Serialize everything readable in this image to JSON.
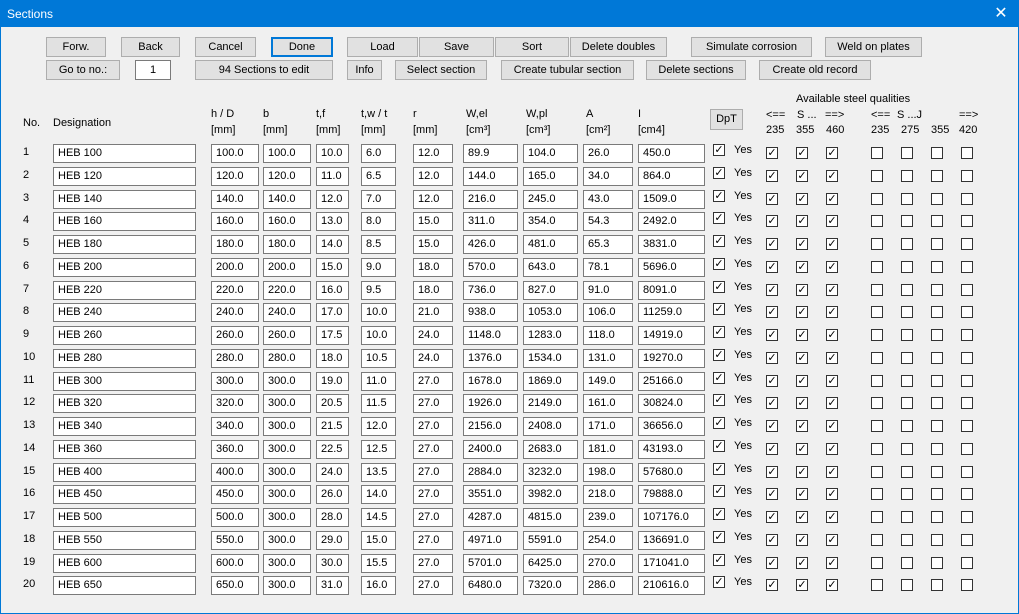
{
  "window": {
    "title": "Sections",
    "close_glyph": "✕"
  },
  "toolbar": {
    "forw": "Forw.",
    "back": "Back",
    "cancel": "Cancel",
    "done": "Done",
    "load": "Load",
    "save": "Save",
    "sort": "Sort",
    "delete_doubles": "Delete doubles",
    "simulate_corrosion": "Simulate corrosion",
    "weld_on_plates": "Weld on plates",
    "go_to_no": "Go to no.:",
    "go_to_value": "1",
    "sections_to_edit": "94 Sections to edit",
    "info": "Info",
    "select_section": "Select section",
    "create_tubular": "Create tubular section",
    "delete_sections": "Delete sections",
    "create_old_record": "Create old record"
  },
  "headers": {
    "no": "No.",
    "designation": "Designation",
    "h": "h / D",
    "b": "b",
    "tf": "t,f",
    "tw": "t,w / t",
    "r": "r",
    "wel": "W,el",
    "wpl": "W,pl",
    "a": "A",
    "i": "I",
    "u_h": "[mm]",
    "u_b": "[mm]",
    "u_tf": "[mm]",
    "u_tw": "[mm]",
    "u_r": "[mm]",
    "u_wel": "[cm³]",
    "u_wpl": "[cm³]",
    "u_a": "[cm²]",
    "u_i": "[cm4]",
    "dpt": "DpT",
    "available": "Available steel qualities",
    "g1_arrow_l": "<==",
    "g1_mid": "S ...",
    "g1_arrow_r": "==>",
    "g2_arrow_l": "<==",
    "g2_mid": "S ...J",
    "g2_arrow_r": "==>",
    "q1": "235",
    "q2": "355",
    "q3": "460",
    "q4": "235",
    "q5": "275",
    "q6": "355",
    "q7": "420"
  },
  "yes_label": "Yes",
  "check_glyph": "✓",
  "rows": [
    {
      "no": "1",
      "designation": "HEB 100",
      "h": "100.0",
      "b": "100.0",
      "tf": "10.0",
      "tw": "6.0",
      "r": "12.0",
      "wel": "89.9",
      "wpl": "104.0",
      "a": "26.0",
      "i": "450.0",
      "dpt": true,
      "q": [
        true,
        true,
        true,
        false,
        false,
        false,
        false
      ]
    },
    {
      "no": "2",
      "designation": "HEB 120",
      "h": "120.0",
      "b": "120.0",
      "tf": "11.0",
      "tw": "6.5",
      "r": "12.0",
      "wel": "144.0",
      "wpl": "165.0",
      "a": "34.0",
      "i": "864.0",
      "dpt": true,
      "q": [
        true,
        true,
        true,
        false,
        false,
        false,
        false
      ]
    },
    {
      "no": "3",
      "designation": "HEB 140",
      "h": "140.0",
      "b": "140.0",
      "tf": "12.0",
      "tw": "7.0",
      "r": "12.0",
      "wel": "216.0",
      "wpl": "245.0",
      "a": "43.0",
      "i": "1509.0",
      "dpt": true,
      "q": [
        true,
        true,
        true,
        false,
        false,
        false,
        false
      ]
    },
    {
      "no": "4",
      "designation": "HEB 160",
      "h": "160.0",
      "b": "160.0",
      "tf": "13.0",
      "tw": "8.0",
      "r": "15.0",
      "wel": "311.0",
      "wpl": "354.0",
      "a": "54.3",
      "i": "2492.0",
      "dpt": true,
      "q": [
        true,
        true,
        true,
        false,
        false,
        false,
        false
      ]
    },
    {
      "no": "5",
      "designation": "HEB 180",
      "h": "180.0",
      "b": "180.0",
      "tf": "14.0",
      "tw": "8.5",
      "r": "15.0",
      "wel": "426.0",
      "wpl": "481.0",
      "a": "65.3",
      "i": "3831.0",
      "dpt": true,
      "q": [
        true,
        true,
        true,
        false,
        false,
        false,
        false
      ]
    },
    {
      "no": "6",
      "designation": "HEB 200",
      "h": "200.0",
      "b": "200.0",
      "tf": "15.0",
      "tw": "9.0",
      "r": "18.0",
      "wel": "570.0",
      "wpl": "643.0",
      "a": "78.1",
      "i": "5696.0",
      "dpt": true,
      "q": [
        true,
        true,
        true,
        false,
        false,
        false,
        false
      ]
    },
    {
      "no": "7",
      "designation": "HEB 220",
      "h": "220.0",
      "b": "220.0",
      "tf": "16.0",
      "tw": "9.5",
      "r": "18.0",
      "wel": "736.0",
      "wpl": "827.0",
      "a": "91.0",
      "i": "8091.0",
      "dpt": true,
      "q": [
        true,
        true,
        true,
        false,
        false,
        false,
        false
      ]
    },
    {
      "no": "8",
      "designation": "HEB 240",
      "h": "240.0",
      "b": "240.0",
      "tf": "17.0",
      "tw": "10.0",
      "r": "21.0",
      "wel": "938.0",
      "wpl": "1053.0",
      "a": "106.0",
      "i": "11259.0",
      "dpt": true,
      "q": [
        true,
        true,
        true,
        false,
        false,
        false,
        false
      ]
    },
    {
      "no": "9",
      "designation": "HEB 260",
      "h": "260.0",
      "b": "260.0",
      "tf": "17.5",
      "tw": "10.0",
      "r": "24.0",
      "wel": "1148.0",
      "wpl": "1283.0",
      "a": "118.0",
      "i": "14919.0",
      "dpt": true,
      "q": [
        true,
        true,
        true,
        false,
        false,
        false,
        false
      ]
    },
    {
      "no": "10",
      "designation": "HEB 280",
      "h": "280.0",
      "b": "280.0",
      "tf": "18.0",
      "tw": "10.5",
      "r": "24.0",
      "wel": "1376.0",
      "wpl": "1534.0",
      "a": "131.0",
      "i": "19270.0",
      "dpt": true,
      "q": [
        true,
        true,
        true,
        false,
        false,
        false,
        false
      ]
    },
    {
      "no": "11",
      "designation": "HEB 300",
      "h": "300.0",
      "b": "300.0",
      "tf": "19.0",
      "tw": "11.0",
      "r": "27.0",
      "wel": "1678.0",
      "wpl": "1869.0",
      "a": "149.0",
      "i": "25166.0",
      "dpt": true,
      "q": [
        true,
        true,
        true,
        false,
        false,
        false,
        false
      ]
    },
    {
      "no": "12",
      "designation": "HEB 320",
      "h": "320.0",
      "b": "300.0",
      "tf": "20.5",
      "tw": "11.5",
      "r": "27.0",
      "wel": "1926.0",
      "wpl": "2149.0",
      "a": "161.0",
      "i": "30824.0",
      "dpt": true,
      "q": [
        true,
        true,
        true,
        false,
        false,
        false,
        false
      ]
    },
    {
      "no": "13",
      "designation": "HEB 340",
      "h": "340.0",
      "b": "300.0",
      "tf": "21.5",
      "tw": "12.0",
      "r": "27.0",
      "wel": "2156.0",
      "wpl": "2408.0",
      "a": "171.0",
      "i": "36656.0",
      "dpt": true,
      "q": [
        true,
        true,
        true,
        false,
        false,
        false,
        false
      ]
    },
    {
      "no": "14",
      "designation": "HEB 360",
      "h": "360.0",
      "b": "300.0",
      "tf": "22.5",
      "tw": "12.5",
      "r": "27.0",
      "wel": "2400.0",
      "wpl": "2683.0",
      "a": "181.0",
      "i": "43193.0",
      "dpt": true,
      "q": [
        true,
        true,
        true,
        false,
        false,
        false,
        false
      ]
    },
    {
      "no": "15",
      "designation": "HEB 400",
      "h": "400.0",
      "b": "300.0",
      "tf": "24.0",
      "tw": "13.5",
      "r": "27.0",
      "wel": "2884.0",
      "wpl": "3232.0",
      "a": "198.0",
      "i": "57680.0",
      "dpt": true,
      "q": [
        true,
        true,
        true,
        false,
        false,
        false,
        false
      ]
    },
    {
      "no": "16",
      "designation": "HEB 450",
      "h": "450.0",
      "b": "300.0",
      "tf": "26.0",
      "tw": "14.0",
      "r": "27.0",
      "wel": "3551.0",
      "wpl": "3982.0",
      "a": "218.0",
      "i": "79888.0",
      "dpt": true,
      "q": [
        true,
        true,
        true,
        false,
        false,
        false,
        false
      ]
    },
    {
      "no": "17",
      "designation": "HEB 500",
      "h": "500.0",
      "b": "300.0",
      "tf": "28.0",
      "tw": "14.5",
      "r": "27.0",
      "wel": "4287.0",
      "wpl": "4815.0",
      "a": "239.0",
      "i": "107176.0",
      "dpt": true,
      "q": [
        true,
        true,
        true,
        false,
        false,
        false,
        false
      ]
    },
    {
      "no": "18",
      "designation": "HEB 550",
      "h": "550.0",
      "b": "300.0",
      "tf": "29.0",
      "tw": "15.0",
      "r": "27.0",
      "wel": "4971.0",
      "wpl": "5591.0",
      "a": "254.0",
      "i": "136691.0",
      "dpt": true,
      "q": [
        true,
        true,
        true,
        false,
        false,
        false,
        false
      ]
    },
    {
      "no": "19",
      "designation": "HEB 600",
      "h": "600.0",
      "b": "300.0",
      "tf": "30.0",
      "tw": "15.5",
      "r": "27.0",
      "wel": "5701.0",
      "wpl": "6425.0",
      "a": "270.0",
      "i": "171041.0",
      "dpt": true,
      "q": [
        true,
        true,
        true,
        false,
        false,
        false,
        false
      ]
    },
    {
      "no": "20",
      "designation": "HEB 650",
      "h": "650.0",
      "b": "300.0",
      "tf": "31.0",
      "tw": "16.0",
      "r": "27.0",
      "wel": "6480.0",
      "wpl": "7320.0",
      "a": "286.0",
      "i": "210616.0",
      "dpt": true,
      "q": [
        true,
        true,
        true,
        false,
        false,
        false,
        false
      ]
    }
  ]
}
